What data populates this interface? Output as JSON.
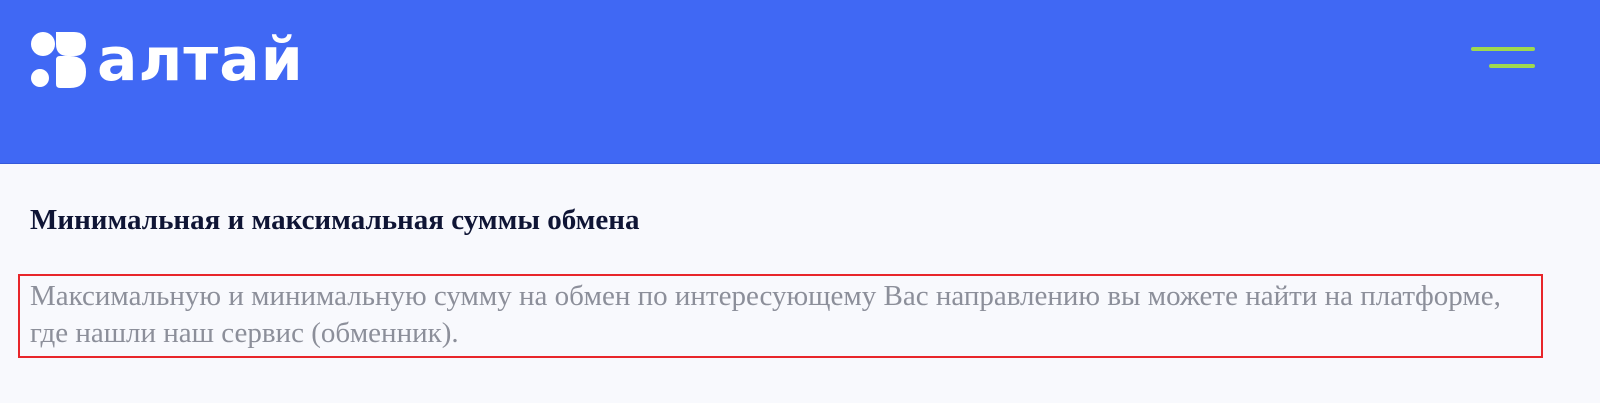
{
  "header": {
    "logo_text": "алтай",
    "menu_icon": "hamburger-menu-icon",
    "colors": {
      "background": "#4068f4",
      "logo": "#ffffff",
      "menu_accent": "#9fd94e"
    }
  },
  "faq": {
    "question": "Минимальная и максимальная суммы обмена",
    "answer": "Максимальную и минимальную сумму на обмен по интересующему Вас направлению вы можете найти на платформе, где нашли наш сервис (обменник)."
  },
  "highlight_color": "#e8262a"
}
